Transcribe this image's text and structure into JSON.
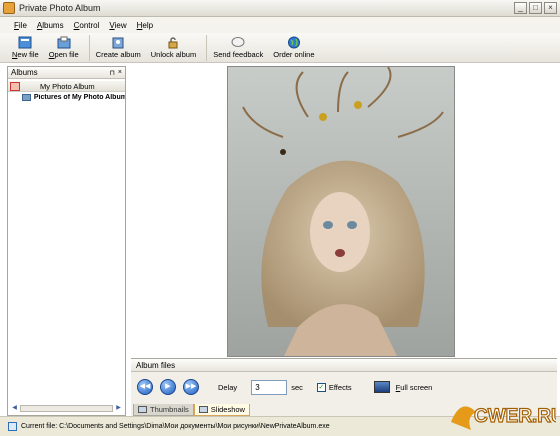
{
  "window": {
    "title": "Private Photo Album",
    "controls": [
      "_",
      "□",
      "×"
    ]
  },
  "menu": [
    "File",
    "Albums",
    "Control",
    "View",
    "Help"
  ],
  "toolbar": {
    "new_file": "New file",
    "open_file": "Open file",
    "create_album": "Create album",
    "unlock_album": "Unlock album",
    "send_feedback": "Send feedback",
    "order_online": "Order online"
  },
  "albums_panel": {
    "title": "Albums",
    "album_name": "My Photo Album",
    "tree_item": "Pictures of My Photo Album"
  },
  "album_files": {
    "title": "Album files",
    "delay_label": "Delay",
    "delay_value": "3",
    "sec_label": "sec",
    "effects_label": "Effects",
    "effects_checked": true,
    "fullscreen_label": "Full screen",
    "tab_thumbnails": "Thumbnails",
    "tab_slideshow": "Slideshow"
  },
  "status": {
    "text": "Current file: C:\\Documents and Settings\\Dima\\Мои документы\\Мои рисунки\\NewPrivateAlbum.exe"
  },
  "watermark": "CWER.RU",
  "colors": {
    "accent": "#1f5fc4",
    "titlebar": "#dedcd2",
    "panel": "#f1efe8"
  }
}
